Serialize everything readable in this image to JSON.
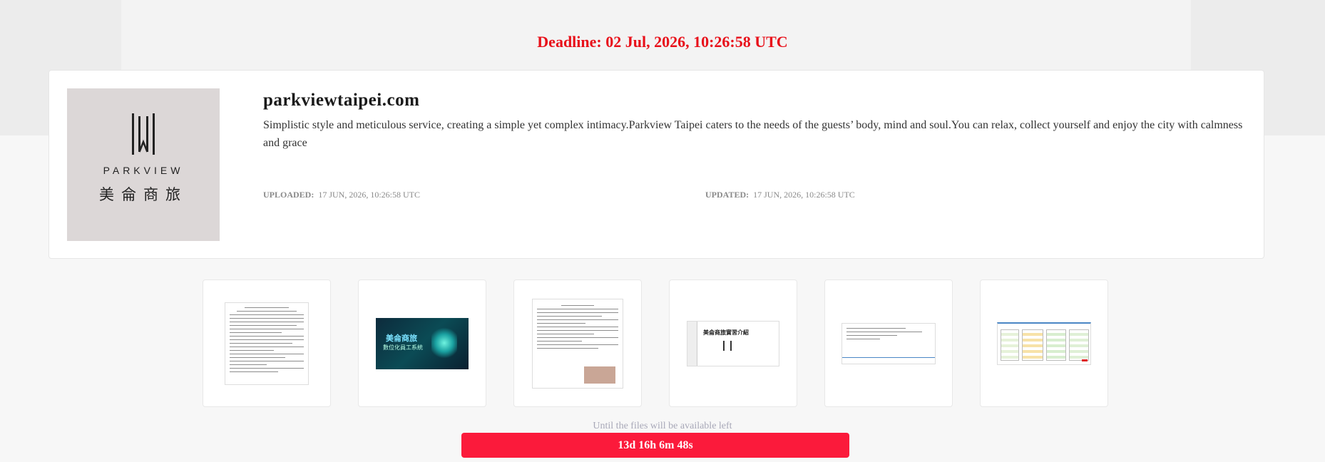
{
  "deadline": "Deadline: 02 Jul, 2026, 10:26:58 UTC",
  "card": {
    "logo": {
      "icon": "parkview-logo-mark",
      "en": "PARKVIEW",
      "zh": "美侖商旅"
    },
    "title": "parkviewtaipei.com",
    "description": "Simplistic style and meticulous service, creating a simple yet complex intimacy.Parkview Taipei caters to the needs of the guests’ body, mind and soul.You can relax, collect yourself and enjoy the city with calmness and grace",
    "uploaded_label": "UPLOADED:",
    "uploaded_value": "17 JUN, 2026, 10:26:58 UTC",
    "updated_label": "UPDATED:",
    "updated_value": "17 JUN, 2026, 10:26:58 UTC"
  },
  "files": [
    {
      "kind": "form-document"
    },
    {
      "kind": "promo-image",
      "title": "美侖商旅",
      "subtitle": "數位化員工系統"
    },
    {
      "kind": "order-document"
    },
    {
      "kind": "presentation",
      "title": "美侖商旅實習介紹"
    },
    {
      "kind": "spreadsheet"
    },
    {
      "kind": "spreadsheet-color"
    }
  ],
  "countdown": {
    "label": "Until the files will be available left",
    "value": "13d 16h 6m 48s"
  },
  "colors": {
    "accent_red": "#fb1a3b",
    "deadline_red": "#e8101a"
  }
}
